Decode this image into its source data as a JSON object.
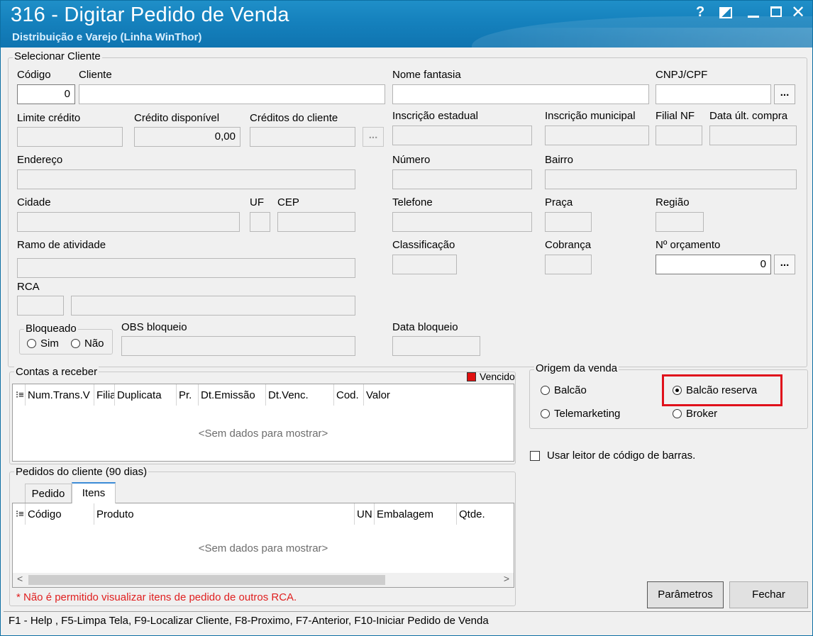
{
  "window": {
    "title": "316 - Digitar Pedido de Venda",
    "subtitle": "Distribuição e Varejo (Linha WinThor)",
    "help_glyph": "?",
    "close_glyph": "✕"
  },
  "cliente_group": {
    "title": "Selecionar Cliente",
    "codigo": {
      "label": "Código",
      "value": "0"
    },
    "cliente": {
      "label": "Cliente",
      "value": ""
    },
    "nome_fantasia": {
      "label": "Nome fantasia",
      "value": ""
    },
    "cnpj_cpf": {
      "label": "CNPJ/CPF",
      "value": "",
      "button": "..."
    },
    "limite_credito": {
      "label": "Limite crédito",
      "value": ""
    },
    "credito_disponivel": {
      "label": "Crédito disponível",
      "value": "0,00"
    },
    "creditos_cliente": {
      "label": "Créditos do cliente",
      "value": "",
      "button": "..."
    },
    "inscricao_estadual": {
      "label": "Inscrição estadual",
      "value": ""
    },
    "inscricao_municipal": {
      "label": "Inscrição municipal",
      "value": ""
    },
    "filial_nf": {
      "label": "Filial NF",
      "value": ""
    },
    "data_ult_compra": {
      "label": "Data últ. compra",
      "value": ""
    },
    "endereco": {
      "label": "Endereço",
      "value": ""
    },
    "numero": {
      "label": "Número",
      "value": ""
    },
    "bairro": {
      "label": "Bairro",
      "value": ""
    },
    "cidade": {
      "label": "Cidade",
      "value": ""
    },
    "uf": {
      "label": "UF",
      "value": ""
    },
    "cep": {
      "label": "CEP",
      "value": ""
    },
    "telefone": {
      "label": "Telefone",
      "value": ""
    },
    "praca": {
      "label": "Praça",
      "value": ""
    },
    "regiao": {
      "label": "Região",
      "value": ""
    },
    "ramo_atividade": {
      "label": "Ramo de atividade",
      "value": ""
    },
    "classificacao": {
      "label": "Classificação",
      "value": ""
    },
    "cobranca": {
      "label": "Cobrança",
      "value": ""
    },
    "num_orcamento": {
      "label": "Nº orçamento",
      "value": "0",
      "button": "..."
    },
    "rca": {
      "label": "RCA",
      "code": "",
      "name": ""
    },
    "bloqueado": {
      "title": "Bloqueado",
      "sim": "Sim",
      "nao": "Não"
    },
    "obs_bloqueio": {
      "label": "OBS bloqueio",
      "value": ""
    },
    "data_bloqueio": {
      "label": "Data bloqueio",
      "value": ""
    }
  },
  "contas_receber": {
    "title": "Contas a receber",
    "legend": "Vencido",
    "legend_color": "#e01010",
    "columns": [
      "Num.Trans.V",
      "Filia",
      "Duplicata",
      "Pr.",
      "Dt.Emissão",
      "Dt.Venc.",
      "Cod.",
      "Valor"
    ],
    "empty": "<Sem dados para mostrar>"
  },
  "origem_venda": {
    "title": "Origem da venda",
    "options": [
      "Balcão",
      "Balcão reserva",
      "Telemarketing",
      "Broker"
    ],
    "selected": "Balcão reserva"
  },
  "barcode_checkbox": {
    "label": "Usar leitor de código de barras.",
    "checked": false
  },
  "pedidos": {
    "title": "Pedidos do cliente (90 dias)",
    "tabs": [
      "Pedido",
      "Itens"
    ],
    "active_tab": "Itens",
    "columns": [
      "Código",
      "Produto",
      "UN",
      "Embalagem",
      "Qtde."
    ],
    "empty": "<Sem dados para mostrar>",
    "warning": "* Não é permitido visualizar itens de pedido de outros RCA."
  },
  "buttons": {
    "parametros": "Parâmetros",
    "fechar": "Fechar"
  },
  "status_bar": "F1 - Help , F5-Limpa Tela, F9-Localizar Cliente, F8-Proximo, F7-Anterior, F10-Iniciar Pedido de Venda",
  "colors": {
    "title_bar": "#1581bd",
    "highlight": "#e0101b",
    "warning": "#e01f1f"
  }
}
